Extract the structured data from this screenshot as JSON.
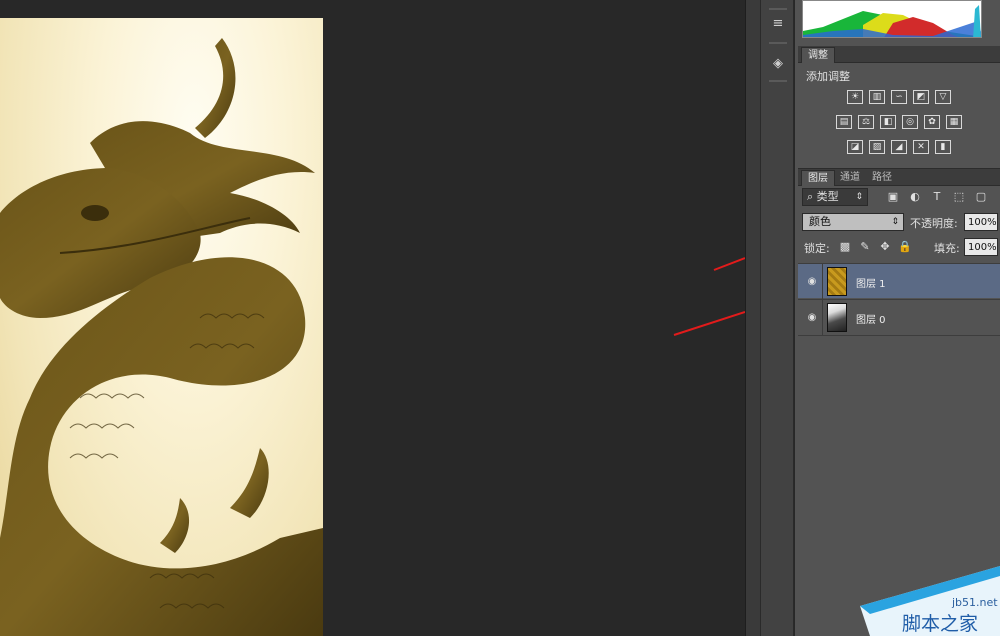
{
  "colors": {
    "accent_arrow": "#e21b1b",
    "selected_layer": "#5b6a85",
    "panel_bg": "#535353"
  },
  "toolstrip": {
    "buttons": [
      {
        "icon": "history-icon",
        "glyph": "≡"
      },
      {
        "icon": "3d-cube-icon",
        "glyph": "◈"
      }
    ]
  },
  "adjustments": {
    "tab_label": "调整",
    "title": "添加调整",
    "row1_icons": [
      "brightness-icon",
      "levels-icon",
      "curves-icon",
      "exposure-icon",
      "vibrance-icon"
    ],
    "row2_icons": [
      "hue-saturation-icon",
      "color-balance-icon",
      "black-white-icon",
      "photo-filter-icon",
      "channel-mixer-icon",
      "color-lookup-icon"
    ],
    "row3_icons": [
      "invert-icon",
      "posterize-icon",
      "threshold-icon",
      "selective-color-icon",
      "gradient-map-icon"
    ]
  },
  "layers_panel": {
    "tabs": [
      "图层",
      "通道",
      "路径"
    ],
    "kind_filter": "类型",
    "blend_mode": "颜色",
    "opacity_label": "不透明度:",
    "opacity_value": "100%",
    "lock_label": "锁定:",
    "fill_label": "填充:",
    "fill_value": "100%",
    "layers": [
      {
        "name": "图层 1",
        "selected": true
      },
      {
        "name": "图层 0",
        "selected": false
      }
    ]
  },
  "watermark": {
    "site": "jb51.net",
    "name": "脚本之家"
  }
}
